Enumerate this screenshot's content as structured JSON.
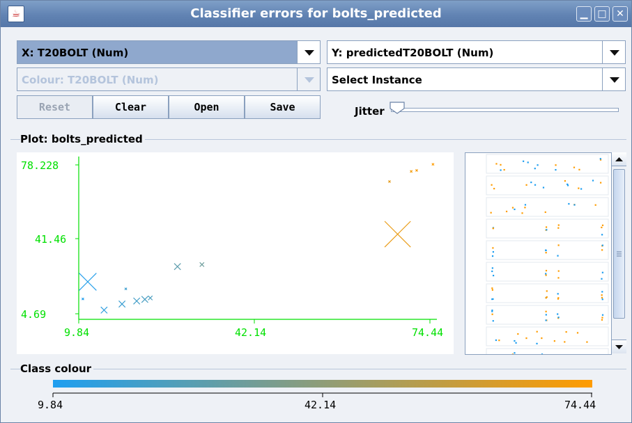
{
  "window": {
    "title": "Classifier errors for bolts_predicted"
  },
  "controls": {
    "x_axis": "X: T20BOLT (Num)",
    "y_axis": "Y: predictedT20BOLT (Num)",
    "colour": "Colour: T20BOLT (Num)",
    "instance": "Select Instance",
    "reset": "Reset",
    "clear": "Clear",
    "open": "Open",
    "save": "Save",
    "jitter_label": "Jitter",
    "jitter_value": 0
  },
  "plot": {
    "group_title": "Plot: bolts_predicted",
    "y_ticks": [
      "78.228",
      "41.46",
      "4.69"
    ],
    "x_ticks": [
      "9.84",
      "42.14",
      "74.44"
    ],
    "axis_color": "#00e000"
  },
  "class_colour": {
    "group_title": "Class colour",
    "ticks": [
      "9.84",
      "42.14",
      "74.44"
    ],
    "gradient_from": "#1e9ef0",
    "gradient_to": "#ff9c00"
  },
  "chart_data": {
    "type": "scatter",
    "xlabel": "T20BOLT",
    "ylabel": "predictedT20BOLT",
    "xlim": [
      9.84,
      74.44
    ],
    "ylim": [
      4.69,
      78.228
    ],
    "x_ticks": [
      9.84,
      42.14,
      74.44
    ],
    "y_ticks": [
      4.69,
      41.46,
      78.228
    ],
    "points": [
      {
        "x": 11.5,
        "y": 20.5,
        "err": 8
      },
      {
        "x": 10.6,
        "y": 12.0,
        "err": 0
      },
      {
        "x": 14.5,
        "y": 6.5,
        "err": 3
      },
      {
        "x": 17.8,
        "y": 9.5,
        "err": 3
      },
      {
        "x": 20.5,
        "y": 11.0,
        "err": 3
      },
      {
        "x": 22.0,
        "y": 11.8,
        "err": 3
      },
      {
        "x": 23.0,
        "y": 12.5,
        "err": 2
      },
      {
        "x": 18.5,
        "y": 17.0,
        "err": 1
      },
      {
        "x": 28.0,
        "y": 28.0,
        "err": 3
      },
      {
        "x": 32.5,
        "y": 29.0,
        "err": 2
      },
      {
        "x": 68.5,
        "y": 44.0,
        "err": 12
      },
      {
        "x": 67.0,
        "y": 70.0,
        "err": 1
      },
      {
        "x": 71.0,
        "y": 75.0,
        "err": 1
      },
      {
        "x": 72.0,
        "y": 75.5,
        "err": 1
      },
      {
        "x": 75.0,
        "y": 78.5,
        "err": 1
      }
    ]
  }
}
